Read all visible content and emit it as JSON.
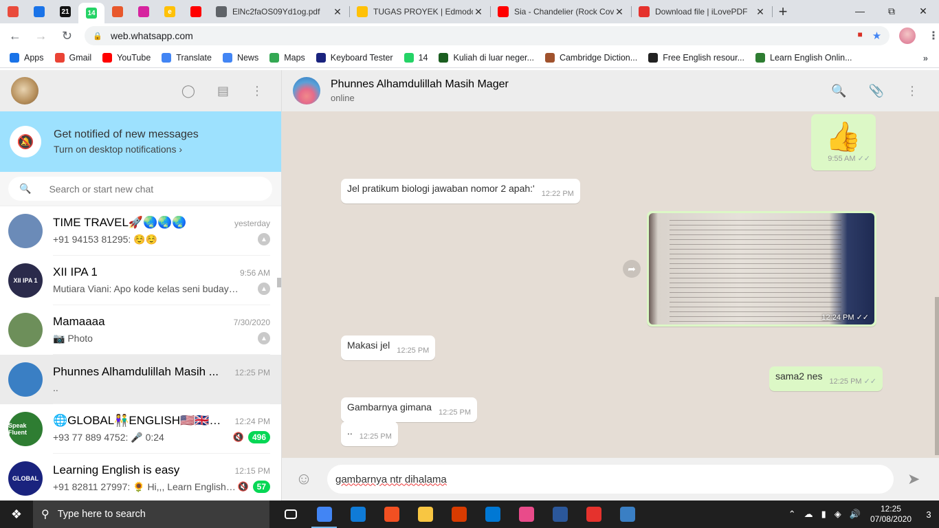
{
  "browser": {
    "pinned_tabs": [
      {
        "icon": "pinwheel-icon",
        "color": "#e94b3c"
      },
      {
        "icon": "drive-icon",
        "color": "#1a73e8"
      },
      {
        "icon": "tv21-icon",
        "color": "#111111",
        "text": "21"
      },
      {
        "icon": "whatsapp-icon",
        "color": "#25d366",
        "text": "14"
      },
      {
        "icon": "bag-icon",
        "color": "#e8582c"
      },
      {
        "icon": "instagram-icon",
        "color": "#d6249f"
      },
      {
        "icon": "edmodo-icon",
        "color": "#ffc107",
        "text": "e"
      },
      {
        "icon": "youtube-icon",
        "color": "#ff0000"
      }
    ],
    "tabs": [
      {
        "label": "ElNc2faOS09Yd1og.pdf",
        "icon": "globe-icon",
        "color": "#5f6368"
      },
      {
        "label": "TUGAS PROYEK | Edmodo",
        "icon": "edmodo-icon",
        "color": "#ffc107"
      },
      {
        "label": "Sia - Chandelier (Rock Cove",
        "icon": "youtube-icon",
        "color": "#ff0000"
      },
      {
        "label": "Download file | iLovePDF",
        "icon": "heart-icon",
        "color": "#e5322d"
      }
    ],
    "url": "web.whatsapp.com",
    "bookmarks": [
      {
        "label": "Apps",
        "icon": "apps-grid-icon",
        "color": "#1a73e8"
      },
      {
        "label": "Gmail",
        "icon": "gmail-icon",
        "color": "#ea4335"
      },
      {
        "label": "YouTube",
        "icon": "youtube-icon",
        "color": "#ff0000"
      },
      {
        "label": "Translate",
        "icon": "translate-icon",
        "color": "#4285f4"
      },
      {
        "label": "News",
        "icon": "news-icon",
        "color": "#4285f4"
      },
      {
        "label": "Maps",
        "icon": "maps-icon",
        "color": "#34a853"
      },
      {
        "label": "Keyboard Tester",
        "icon": "k-icon",
        "color": "#1a237e"
      },
      {
        "label": "14",
        "icon": "whatsapp-icon",
        "color": "#25d366"
      },
      {
        "label": "Kuliah di luar neger...",
        "icon": "hc-icon",
        "color": "#1b5e20"
      },
      {
        "label": "Cambridge Diction...",
        "icon": "cambridge-icon",
        "color": "#a0522d"
      },
      {
        "label": "Free English resour...",
        "icon": "ef-icon",
        "color": "#222222"
      },
      {
        "label": "Learn English Onlin...",
        "icon": "learn-english-icon",
        "color": "#2e7d32"
      }
    ]
  },
  "sidebar": {
    "notify_title": "Get notified of new messages",
    "notify_sub": "Turn on desktop notifications ›",
    "search_placeholder": "Search or start new chat",
    "chats": [
      {
        "name": "TIME TRAVEL🚀🌏🌏🌏",
        "time": "yesterday",
        "preview": "+91 94153 81295: ☺️☺️",
        "pinned": true,
        "avatar_color": "#6b8bb8"
      },
      {
        "name": "XII IPA 1",
        "time": "9:56 AM",
        "preview": "Mutiara Viani: Apo kode kelas seni budaya k...",
        "pinned": true,
        "avatar_color": "#2b2b4b",
        "avatar_text": "XII IPA 1"
      },
      {
        "name": "Mamaaaa",
        "time": "7/30/2020",
        "preview": "📷 Photo",
        "pinned": true,
        "avatar_color": "#6d8f5a"
      },
      {
        "name": "Phunnes Alhamdulillah Masih ...",
        "time": "12:25 PM",
        "preview": "..",
        "active": true,
        "avatar_color": "#3a7fc4"
      },
      {
        "name": "🌐GLOBAL👫ENGLISH🇺🇸🇬🇧🇮🇳...",
        "time": "12:24 PM",
        "preview": "+93 77 889 4752: 🎤 0:24",
        "muted": true,
        "badge": "496",
        "avatar_color": "#2e7d32",
        "avatar_text": "Speak Fluent"
      },
      {
        "name": "Learning English is easy",
        "time": "12:15 PM",
        "preview": "+91 82811 27997: 🌻 Hi,,, Learn English i...",
        "muted": true,
        "badge": "57",
        "avatar_color": "#1a237e",
        "avatar_text": "GLOBAL"
      }
    ]
  },
  "conversation": {
    "name": "Phunnes Alhamdulillah Masih Mager",
    "status": "online",
    "messages": [
      {
        "dir": "out",
        "text": "👍",
        "time": "9:55 AM",
        "ticks": true
      },
      {
        "dir": "in",
        "text": "Jel pratikum biologi jawaban nomor 2 apah:'",
        "time": "12:22 PM"
      },
      {
        "dir": "out",
        "type": "image",
        "time": "12:24 PM",
        "ticks": true
      },
      {
        "dir": "in",
        "text": "Makasi jel",
        "time": "12:25 PM"
      },
      {
        "dir": "out",
        "text": "sama2 nes",
        "time": "12:25 PM",
        "ticks": true
      },
      {
        "dir": "in",
        "text": "Gambarnya gimana",
        "time": "12:25 PM"
      },
      {
        "dir": "in",
        "text": "..",
        "time": "12:25 PM"
      }
    ],
    "composer_text": "gambarnya ntr dihalama"
  },
  "taskbar": {
    "search_placeholder": "Type here to search",
    "apps": [
      {
        "icon": "task-view-icon",
        "color": "#1f1f1f"
      },
      {
        "icon": "chrome-icon",
        "color": "#4285f4",
        "open": true
      },
      {
        "icon": "edge-icon",
        "color": "#0f7bd7"
      },
      {
        "icon": "store-icon",
        "color": "#f25022"
      },
      {
        "icon": "file-explorer-icon",
        "color": "#f8c642"
      },
      {
        "icon": "office-icon",
        "color": "#d83b01"
      },
      {
        "icon": "mail-icon",
        "color": "#0078d4"
      },
      {
        "icon": "itunes-icon",
        "color": "#e94b8a"
      },
      {
        "icon": "word-icon",
        "color": "#2b579a"
      },
      {
        "icon": "pdf-icon",
        "color": "#e5322d"
      },
      {
        "icon": "photos-icon",
        "color": "#3a7fc4"
      }
    ],
    "time": "12:25",
    "date": "07/08/2020",
    "notifications": "3"
  }
}
